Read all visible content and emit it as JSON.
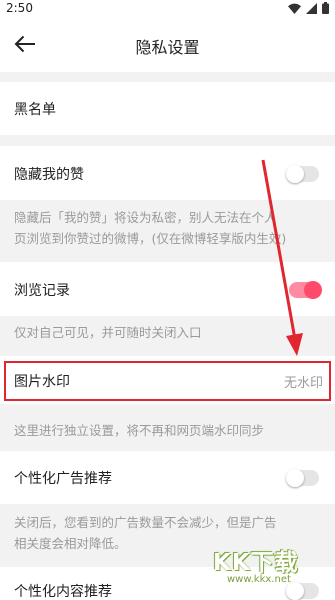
{
  "status": {
    "time": "2:50",
    "icons": [
      "wifi-icon",
      "signal-icon",
      "battery-icon"
    ]
  },
  "header": {
    "title": "隐私设置",
    "back_icon": "arrow-left-icon"
  },
  "rows": {
    "blacklist": {
      "label": "黑名单"
    },
    "hide_likes": {
      "label": "隐藏我的赞",
      "enabled": false
    },
    "history": {
      "label": "浏览记录",
      "enabled": true
    },
    "watermark": {
      "label": "图片水印",
      "value": "无水印"
    },
    "personal_ads": {
      "label": "个性化广告推荐",
      "enabled": false
    },
    "personal_content": {
      "label": "个性化内容推荐",
      "enabled": false
    }
  },
  "descriptions": {
    "hide_likes_line1": "隐藏后「我的赞」将设为私密，别人无法在个人",
    "hide_likes_line2": "页浏览到你赞过的微博，(仅在微博轻享版内生效)",
    "history": "仅对自己可见，并可随时关闭入口",
    "watermark": "这里进行独立设置，将不再和网页端水印同步",
    "ads_line1": "关闭后，您看到的广告数量不会减少，但是广告",
    "ads_line2": "相关度会相对降低。"
  },
  "site_watermark": {
    "logo": "KK下载",
    "url": "www.kkx.net"
  },
  "colors": {
    "accent": "#ff4b6b",
    "annotation": "#e0262f",
    "background": "#f2f2f2"
  }
}
